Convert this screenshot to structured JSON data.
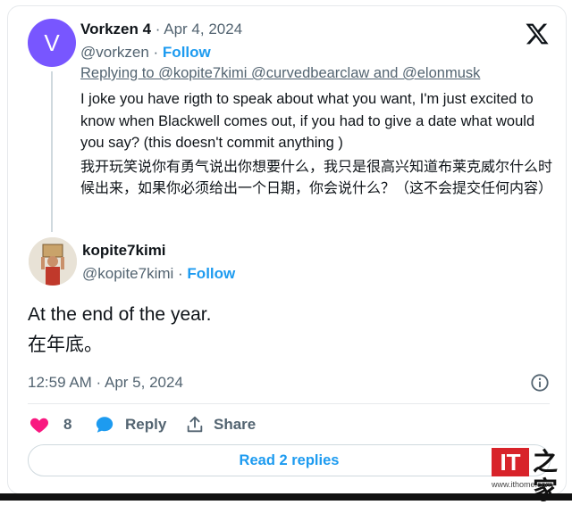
{
  "tweet1": {
    "avatar_letter": "V",
    "display_name": "Vorkzen 4",
    "date": "Apr 4, 2024",
    "handle": "@vorkzen",
    "follow_label": "Follow",
    "replying_to": "Replying to @kopite7kimi @curvedbearclaw and @elonmusk",
    "text_en": "I joke you have rigth to speak about what you want, I'm just excited to know when Blackwell comes out, if you had to give a date what would you say? (this doesn't commit anything )",
    "text_zh": "我开玩笑说你有勇气说出你想要什么，我只是很高兴知道布莱克威尔什么时候出来，如果你必须给出一个日期，你会说什么？（这不会提交任何内容）"
  },
  "tweet2": {
    "display_name": "kopite7kimi",
    "handle": "@kopite7kimi",
    "follow_label": "Follow",
    "text_en": "At the end of the year.",
    "text_zh": "在年底。",
    "timestamp": "12:59 AM · Apr 5, 2024"
  },
  "actions": {
    "like_count": "8",
    "reply_label": "Reply",
    "share_label": "Share"
  },
  "read_replies_label": "Read 2 replies",
  "watermark": {
    "logo_text": "IT",
    "logo_zh": "之家",
    "url": "www.ithome.com"
  },
  "colors": {
    "accent": "#1d9bf0",
    "avatar_v": "#7856ff",
    "like": "#f91880",
    "muted": "#536471"
  }
}
